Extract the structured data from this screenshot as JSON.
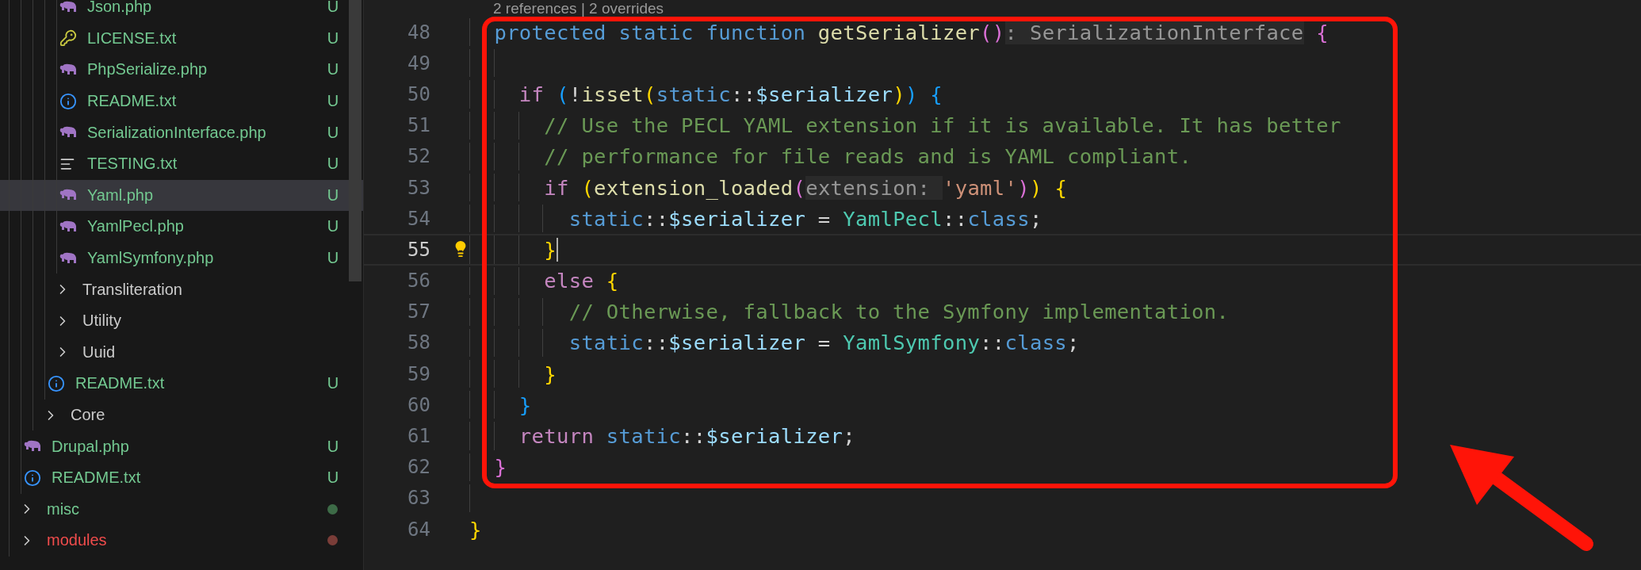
{
  "sidebar": {
    "tree": [
      {
        "children": [
          {
            "children": [
              {
                "children": [
                  {
                    "children": [
                      {
                        "children": [
                          {
                            "label": "Json.php",
                            "kind": "php",
                            "untracked": true,
                            "errors": false,
                            "status": "U",
                            "selected": false
                          },
                          {
                            "label": "LICENSE.txt",
                            "kind": "license",
                            "untracked": true,
                            "errors": false,
                            "status": "U",
                            "selected": false
                          },
                          {
                            "label": "PhpSerialize.php",
                            "kind": "php",
                            "untracked": true,
                            "errors": false,
                            "status": "U",
                            "selected": false
                          },
                          {
                            "label": "README.txt",
                            "kind": "info",
                            "untracked": true,
                            "errors": false,
                            "status": "U",
                            "selected": false
                          },
                          {
                            "label": "SerializationInterface.php",
                            "kind": "php",
                            "untracked": true,
                            "errors": false,
                            "status": "U",
                            "selected": false
                          },
                          {
                            "label": "TESTING.txt",
                            "kind": "text",
                            "untracked": true,
                            "errors": false,
                            "status": "U",
                            "selected": false
                          },
                          {
                            "label": "Yaml.php",
                            "kind": "php",
                            "untracked": true,
                            "errors": false,
                            "status": "U",
                            "selected": true
                          },
                          {
                            "label": "YamlPecl.php",
                            "kind": "php",
                            "untracked": true,
                            "errors": false,
                            "status": "U",
                            "selected": false
                          },
                          {
                            "label": "YamlSymfony.php",
                            "kind": "php",
                            "untracked": true,
                            "errors": false,
                            "status": "U",
                            "selected": false
                          }
                        ]
                      },
                      {
                        "label": "Transliteration",
                        "kind": "folder",
                        "untracked": false,
                        "errors": false,
                        "selected": false
                      },
                      {
                        "label": "Utility",
                        "kind": "folder",
                        "untracked": false,
                        "errors": false,
                        "selected": false
                      },
                      {
                        "label": "Uuid",
                        "kind": "folder",
                        "untracked": false,
                        "errors": false,
                        "selected": false
                      },
                      {
                        "label": "README.txt",
                        "kind": "info",
                        "untracked": true,
                        "errors": false,
                        "status": "U",
                        "selected": false
                      }
                    ]
                  },
                  {
                    "label": "Core",
                    "kind": "folder",
                    "untracked": false,
                    "errors": false,
                    "selected": false
                  }
                ]
              },
              {
                "label": "Drupal.php",
                "kind": "php",
                "untracked": true,
                "errors": false,
                "status": "U",
                "selected": false
              },
              {
                "label": "README.txt",
                "kind": "info",
                "untracked": true,
                "errors": false,
                "status": "U",
                "selected": false
              }
            ]
          },
          {
            "label": "misc",
            "kind": "folder",
            "untracked": true,
            "errors": false,
            "color": "#3d6b47",
            "selected": false
          },
          {
            "label": "modules",
            "kind": "folder",
            "errors": true,
            "color": "#7a3d38",
            "selected": false
          }
        ]
      }
    ]
  },
  "editor": {
    "codelens": "2 references | 2 overrides",
    "lines": [
      {
        "number": "48",
        "current": false,
        "tokens": [
          {
            "kind": "keyword",
            "text": "  protected static function "
          },
          {
            "kind": "function",
            "text": "getSerializer"
          },
          {
            "kind": "b2",
            "text": "()"
          },
          {
            "kind": "hint",
            "text": ": SerializationInterface"
          },
          {
            "kind": "b2",
            "text": " {"
          }
        ]
      },
      {
        "number": "49",
        "current": false
      },
      {
        "number": "50",
        "current": false,
        "tokens": [
          {
            "kind": "control",
            "text": "    if "
          },
          {
            "kind": "b3",
            "text": "("
          },
          {
            "kind": "plain",
            "text": "!"
          },
          {
            "kind": "function",
            "text": "isset"
          },
          {
            "kind": "b1",
            "text": "("
          },
          {
            "kind": "keyword",
            "text": "static"
          },
          {
            "kind": "plain",
            "text": "::"
          },
          {
            "kind": "variable",
            "text": "$serializer"
          },
          {
            "kind": "b1",
            "text": ")"
          },
          {
            "kind": "b3",
            "text": ")"
          },
          {
            "kind": "b3",
            "text": " {"
          }
        ]
      },
      {
        "number": "51",
        "current": false,
        "tokens": [
          {
            "kind": "comment",
            "text": "      // Use the PECL YAML extension if it is available. It has better"
          }
        ]
      },
      {
        "number": "52",
        "current": false,
        "tokens": [
          {
            "kind": "comment",
            "text": "      // performance for file reads and is YAML compliant."
          }
        ]
      },
      {
        "number": "53",
        "current": false,
        "tokens": [
          {
            "kind": "control",
            "text": "      if "
          },
          {
            "kind": "b1",
            "text": "("
          },
          {
            "kind": "function",
            "text": "extension_loaded"
          },
          {
            "kind": "b2",
            "text": "("
          },
          {
            "kind": "hint",
            "text": "extension: "
          },
          {
            "kind": "string",
            "text": "'yaml'"
          },
          {
            "kind": "b2",
            "text": ")"
          },
          {
            "kind": "b1",
            "text": ")"
          },
          {
            "kind": "b1",
            "text": " {"
          }
        ]
      },
      {
        "number": "54",
        "current": false,
        "tokens": [
          {
            "kind": "keyword",
            "text": "        static"
          },
          {
            "kind": "plain",
            "text": "::"
          },
          {
            "kind": "variable",
            "text": "$serializer"
          },
          {
            "kind": "plain",
            "text": " = "
          },
          {
            "kind": "class",
            "text": "YamlPecl"
          },
          {
            "kind": "plain",
            "text": "::"
          },
          {
            "kind": "keyword",
            "text": "class"
          },
          {
            "kind": "plain",
            "text": ";"
          }
        ]
      },
      {
        "number": "55",
        "current": true,
        "tokens": [
          {
            "kind": "b1",
            "text": "      }"
          }
        ]
      },
      {
        "number": "56",
        "current": false,
        "tokens": [
          {
            "kind": "control",
            "text": "      else "
          },
          {
            "kind": "b1",
            "text": "{"
          }
        ]
      },
      {
        "number": "57",
        "current": false,
        "tokens": [
          {
            "kind": "comment",
            "text": "        // Otherwise, fallback to the Symfony implementation."
          }
        ]
      },
      {
        "number": "58",
        "current": false,
        "tokens": [
          {
            "kind": "keyword",
            "text": "        static"
          },
          {
            "kind": "plain",
            "text": "::"
          },
          {
            "kind": "variable",
            "text": "$serializer"
          },
          {
            "kind": "plain",
            "text": " = "
          },
          {
            "kind": "class",
            "text": "YamlSymfony"
          },
          {
            "kind": "plain",
            "text": "::"
          },
          {
            "kind": "keyword",
            "text": "class"
          },
          {
            "kind": "plain",
            "text": ";"
          }
        ]
      },
      {
        "number": "59",
        "current": false,
        "tokens": [
          {
            "kind": "b1",
            "text": "      }"
          }
        ]
      },
      {
        "number": "60",
        "current": false,
        "tokens": [
          {
            "kind": "b3",
            "text": "    }"
          }
        ]
      },
      {
        "number": "61",
        "current": false,
        "tokens": [
          {
            "kind": "control",
            "text": "    return "
          },
          {
            "kind": "keyword",
            "text": "static"
          },
          {
            "kind": "plain",
            "text": "::"
          },
          {
            "kind": "variable",
            "text": "$serializer"
          },
          {
            "kind": "plain",
            "text": ";"
          }
        ]
      },
      {
        "number": "62",
        "current": false,
        "tokens": [
          {
            "kind": "b2",
            "text": "  }"
          }
        ]
      },
      {
        "number": "63",
        "current": false
      },
      {
        "number": "64",
        "current": false,
        "tokens": [
          {
            "kind": "b1",
            "text": "}"
          }
        ]
      }
    ]
  }
}
